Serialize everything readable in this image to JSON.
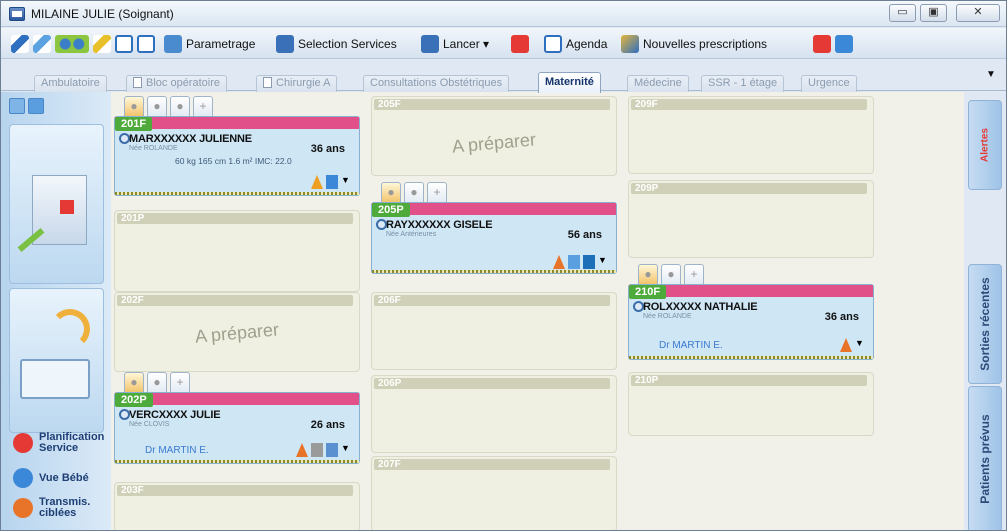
{
  "window": {
    "title": "MILAINE JULIE (Soignant)",
    "buttons": [
      "▭",
      "▣",
      "✕"
    ]
  },
  "toolbar": {
    "parametrage": "Parametrage",
    "selection_services": "Selection Services",
    "lancer": "Lancer ▾",
    "agenda": "Agenda",
    "nouvelles_prescriptions": "Nouvelles prescriptions"
  },
  "tabs": [
    "Ambulatoire",
    "Bloc opératoire",
    "Chirurgie A",
    "Consultations Obstétriques",
    "Maternité",
    "Médecine",
    "SSR - 1 étage",
    "Urgence"
  ],
  "active_tab": "Maternité",
  "left_nav": {
    "planification": "Planification Service",
    "vue_bebe": "Vue Bébé",
    "transmis": "Transmis. ciblées"
  },
  "rooms": {
    "r205f": "205F",
    "r209f": "209F",
    "r209p": "209P",
    "r201p": "201P",
    "r206f": "206F",
    "r202f": "202F",
    "r206p": "206P",
    "r210p": "210P",
    "r207f": "207F",
    "r203f": "203F",
    "prep_label": "A préparer"
  },
  "patients": {
    "p201f": {
      "room": "201F",
      "name": "MARXXXXXX JULIENNE",
      "subtitle": "Née ROLANDE",
      "age": "36 ans",
      "metrics": "60 kg  165 cm  1.6 m²  IMC: 22.0"
    },
    "p205p": {
      "room": "205P",
      "name": "RAYXXXXXX GISELE",
      "subtitle": "Née Antérieures",
      "age": "56 ans"
    },
    "p210f": {
      "room": "210F",
      "name": "ROLXXXXX NATHALIE",
      "subtitle": "Née ROLANDE",
      "age": "36 ans",
      "doctor": "Dr MARTIN E."
    },
    "p202p": {
      "room": "202P",
      "name": "VERCXXXX JULIE",
      "subtitle": "Née CLOVIS",
      "age": "26 ans",
      "doctor": "Dr MARTIN E."
    }
  },
  "right_tabs": {
    "sorties": "Sorties récentes",
    "prevus": "Patients prévus",
    "alertes": "Alertes"
  },
  "tab_plus": "+",
  "colors": {
    "room_bar": "#4eaa3a",
    "alert_bar": "#e2508a",
    "card_bg": "#cfe6f5"
  }
}
